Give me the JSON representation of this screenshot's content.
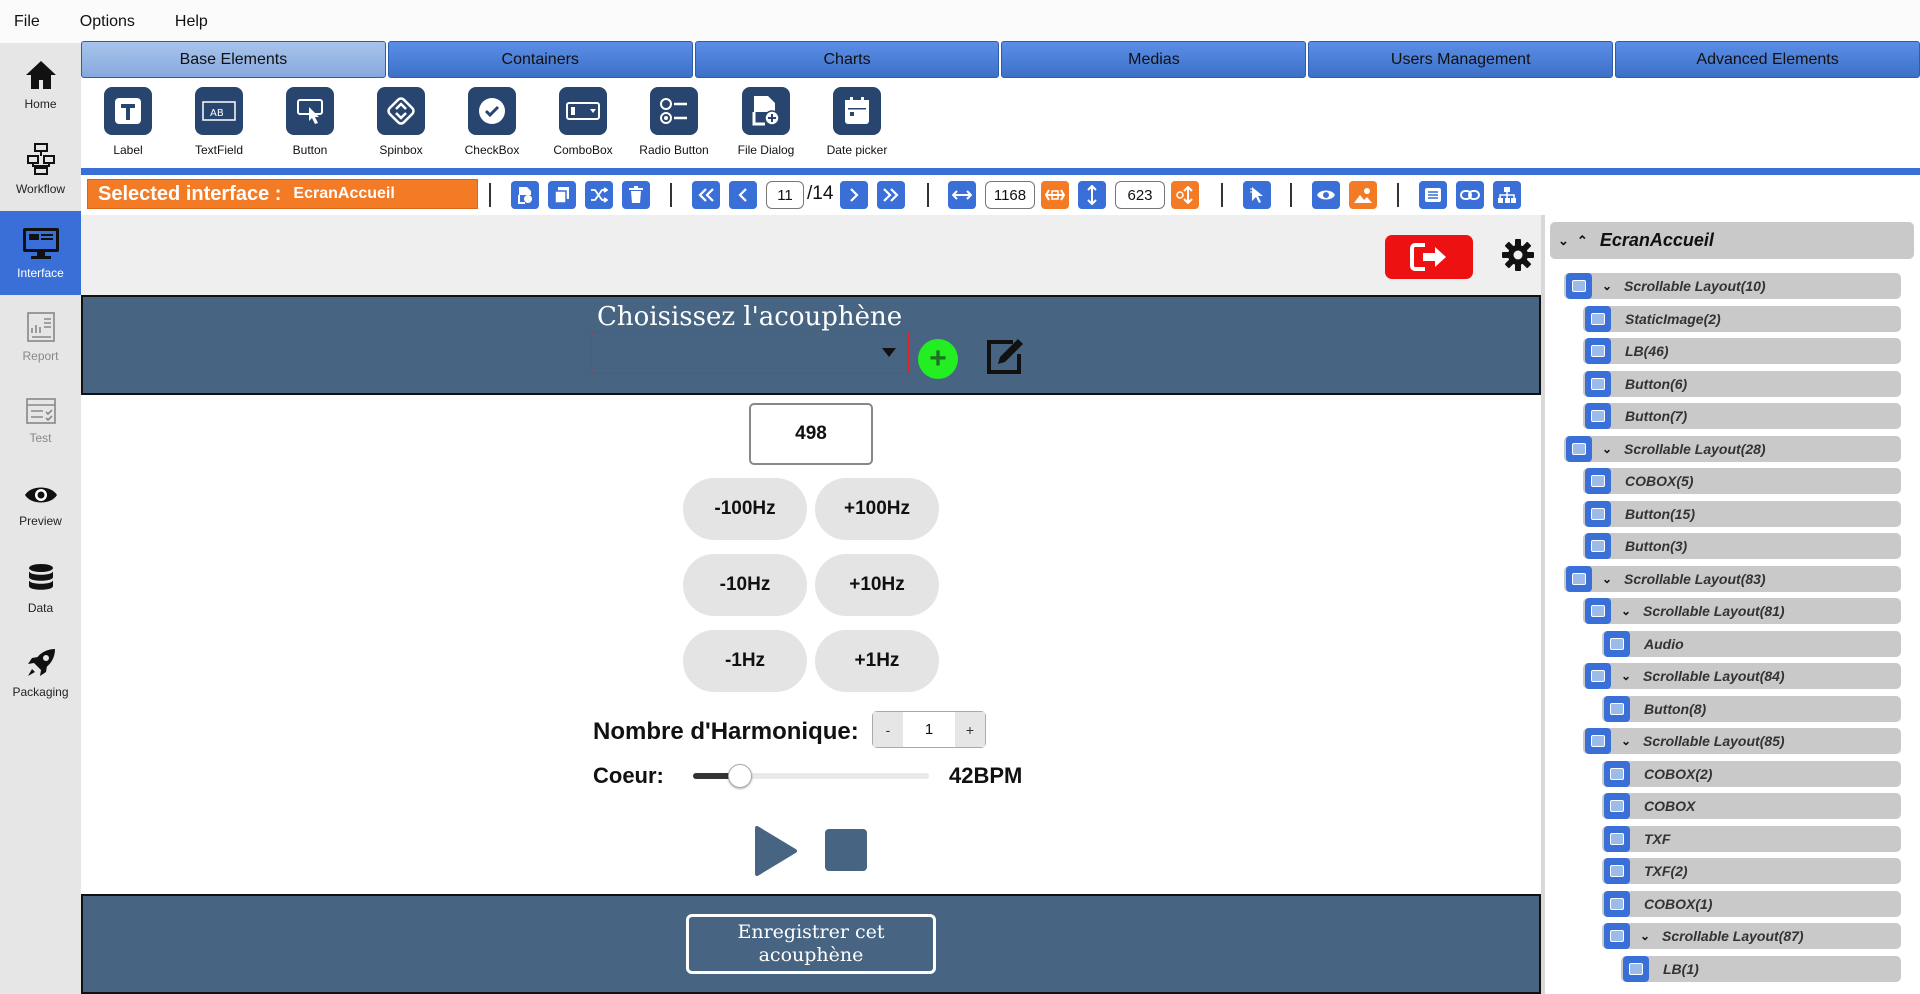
{
  "menu": [
    "File",
    "Options",
    "Help"
  ],
  "nav": [
    {
      "label": "Home",
      "icon": "home-icon"
    },
    {
      "label": "Workflow",
      "icon": "workflow-icon"
    },
    {
      "label": "Interface",
      "icon": "monitor-icon"
    },
    {
      "label": "Report",
      "icon": "report-icon"
    },
    {
      "label": "Test",
      "icon": "checklist-icon"
    },
    {
      "label": "Preview",
      "icon": "eye-icon"
    },
    {
      "label": "Data",
      "icon": "database-icon"
    },
    {
      "label": "Packaging",
      "icon": "rocket-icon"
    }
  ],
  "tabs": [
    "Base Elements",
    "Containers",
    "Charts",
    "Medias",
    "Users Management",
    "Advanced Elements"
  ],
  "palette": [
    {
      "label": "Label",
      "icon": "label-icon"
    },
    {
      "label": "TextField",
      "icon": "textfield-icon"
    },
    {
      "label": "Button",
      "icon": "button-icon"
    },
    {
      "label": "Spinbox",
      "icon": "spinbox-icon"
    },
    {
      "label": "CheckBox",
      "icon": "checkbox-icon"
    },
    {
      "label": "ComboBox",
      "icon": "combobox-icon"
    },
    {
      "label": "Radio Button",
      "icon": "radio-button-icon"
    },
    {
      "label": "File Dialog",
      "icon": "file-dialog-icon"
    },
    {
      "label": "Date picker",
      "icon": "date-picker-icon"
    }
  ],
  "toolbar": {
    "selected_label": "Selected interface :",
    "selected_value": "EcranAccueil",
    "page_current": "11",
    "page_total": "/14",
    "width_value": "1168",
    "height_value": "623"
  },
  "canvas": {
    "title": "Choisissez l'acouphène",
    "frequency": "498",
    "freq_buttons": [
      "-100Hz",
      "+100Hz",
      "-10Hz",
      "+10Hz",
      "-1Hz",
      "+1Hz"
    ],
    "harmonics_label": "Nombre d'Harmonique:",
    "harmonics_value": "1",
    "spin_minus": "-",
    "spin_plus": "+",
    "heart_label": "Coeur:",
    "heart_value": "42BPM",
    "heart_slider_fraction": 0.2,
    "save_label": "Enregistrer cet acouphène",
    "add_symbol": "+"
  },
  "tree": {
    "root": "EcranAccueil",
    "nodes": [
      {
        "label": "Scrollable Layout(10)",
        "group": true
      },
      {
        "label": "StaticImage(2)",
        "group": false
      },
      {
        "label": "LB(46)",
        "group": false
      },
      {
        "label": "Button(6)",
        "group": false
      },
      {
        "label": "Button(7)",
        "group": false
      },
      {
        "label": "Scrollable Layout(28)",
        "group": true
      },
      {
        "label": "COBOX(5)",
        "group": false
      },
      {
        "label": "Button(15)",
        "group": false
      },
      {
        "label": "Button(3)",
        "group": false
      },
      {
        "label": "Scrollable Layout(83)",
        "group": true
      },
      {
        "label": "Scrollable Layout(81)",
        "group": true
      },
      {
        "label": "Audio",
        "group": false
      },
      {
        "label": "Scrollable Layout(84)",
        "group": true
      },
      {
        "label": "Button(8)",
        "group": false
      },
      {
        "label": "Scrollable Layout(85)",
        "group": true
      },
      {
        "label": "COBOX(2)",
        "group": false
      },
      {
        "label": "COBOX",
        "group": false
      },
      {
        "label": "TXF",
        "group": false
      },
      {
        "label": "TXF(2)",
        "group": false
      },
      {
        "label": "COBOX(1)",
        "group": false
      },
      {
        "label": "Scrollable Layout(87)",
        "group": true
      },
      {
        "label": "LB(1)",
        "group": false
      }
    ]
  },
  "colors": {
    "accent": "#3a6fd8",
    "selected_interface": "#f47b25",
    "band": "#476582",
    "logout": "#ee1111",
    "add": "#22ee22"
  }
}
